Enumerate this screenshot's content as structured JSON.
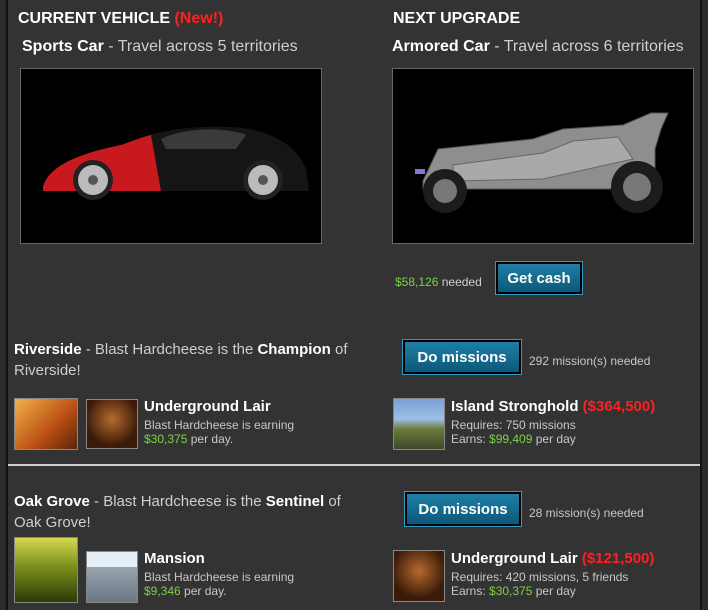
{
  "current": {
    "heading": "CURRENT VEHICLE",
    "new_badge": "(New!)",
    "vehicle_name": "Sports Car",
    "vehicle_desc": " - Travel across 5 territories"
  },
  "upgrade": {
    "heading": "NEXT UPGRADE",
    "vehicle_name": "Armored Car",
    "vehicle_desc": " - Travel across 6 territories",
    "cash_amount": "$58,126",
    "cash_suffix": " needed",
    "get_cash_label": "Get cash"
  },
  "territories": [
    {
      "name": "Riverside",
      "desc_pre": " - Blast Hardcheese is the ",
      "rank": "Champion",
      "desc_post_of": " of",
      "desc_line2": "Riverside!",
      "button_label": "Do missions",
      "missions_needed": "292 mission(s) needed",
      "owned": {
        "title": "Underground Lair",
        "line1": "Blast Hardcheese is earning",
        "earning": "$30,375",
        "earning_suffix": " per day."
      },
      "next": {
        "title": "Island Stronghold",
        "price": "($364,500)",
        "requires": "Requires: 750 missions",
        "earns_label": "Earns: ",
        "earns_amount": "$99,409",
        "earns_suffix": " per day"
      }
    },
    {
      "name": "Oak Grove",
      "desc_pre": " - Blast Hardcheese is the ",
      "rank": "Sentinel",
      "desc_post_of": " of",
      "desc_line2": "Oak Grove!",
      "button_label": "Do missions",
      "missions_needed": "28 mission(s) needed",
      "owned": {
        "title": "Mansion",
        "line1": "Blast Hardcheese is earning",
        "earning": "$9,346",
        "earning_suffix": " per day."
      },
      "next": {
        "title": "Underground Lair",
        "price": "($121,500)",
        "requires": "Requires: 420 missions, 5 friends",
        "earns_label": "Earns: ",
        "earns_amount": "$30,375",
        "earns_suffix": " per day"
      }
    }
  ],
  "colors": {
    "accent_green": "#7fd14a",
    "alert_red": "#ff2020",
    "button_blue": "#1a6f94"
  }
}
